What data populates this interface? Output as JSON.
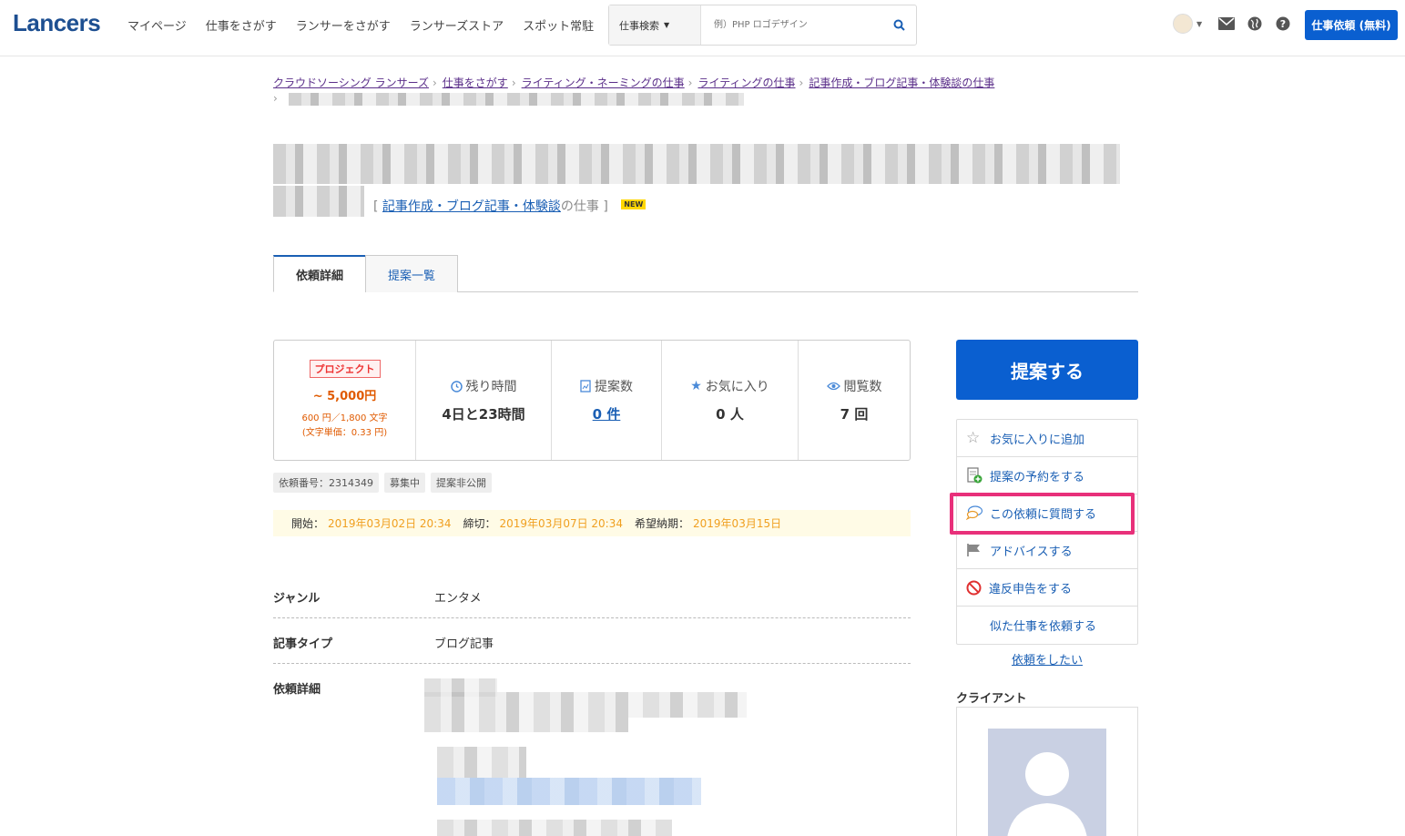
{
  "header": {
    "logo": "Lancers",
    "nav": [
      "マイページ",
      "仕事をさがす",
      "ランサーをさがす",
      "ランサーズストア",
      "スポット常駐"
    ],
    "search": {
      "category": "仕事検索",
      "placeholder": "例）PHP ロゴデザイン"
    },
    "post_button": "仕事依頼 (無料)"
  },
  "breadcrumbs": [
    "クラウドソーシング ランサーズ",
    "仕事をさがす",
    "ライティング・ネーミングの仕事",
    "ライティングの仕事",
    "記事作成・ブログ記事・体験談の仕事"
  ],
  "category_line": {
    "open": "[",
    "link": "記事作成・ブログ記事・体験談",
    "suffix": "の仕事 ]",
    "badge": "NEW"
  },
  "tabs": {
    "detail": "依頼詳細",
    "proposals": "提案一覧"
  },
  "stats": {
    "badge": "プロジェクト",
    "price": "~ 5,000円",
    "price_sub1": "600 円／1,800 文字",
    "price_sub2": "(文字単価：0.33 円)",
    "remaining_label": "残り時間",
    "remaining_value": "4日と23時間",
    "proposals_label": "提案数",
    "proposals_value": "0 件",
    "favorites_label": "お気に入り",
    "favorites_value": "0 人",
    "views_label": "閲覧数",
    "views_value": "7 回"
  },
  "tags": [
    "依頼番号：2314349",
    "募集中",
    "提案非公開"
  ],
  "dates": {
    "start_label": "開始：",
    "start": "2019年03月02日 20:34",
    "end_label": "締切：",
    "end": "2019年03月07日 20:34",
    "due_label": "希望納期：",
    "due": "2019年03月15日"
  },
  "details": {
    "genre_label": "ジャンル",
    "genre": "エンタメ",
    "type_label": "記事タイプ",
    "type": "ブログ記事",
    "detail_label": "依頼詳細"
  },
  "sidebar": {
    "propose": "提案する",
    "actions": [
      "お気に入りに追加",
      "提案の予約をする",
      "この依頼に質問する",
      "アドバイスする",
      "違反申告をする",
      "似た仕事を依頼する"
    ],
    "want": "依頼をしたい",
    "client_heading": "クライアント"
  },
  "colors": {
    "brand": "#1d4f91",
    "primary_button": "#0a5fd0",
    "highlight": "#e8307a",
    "price": "#e05a00"
  }
}
